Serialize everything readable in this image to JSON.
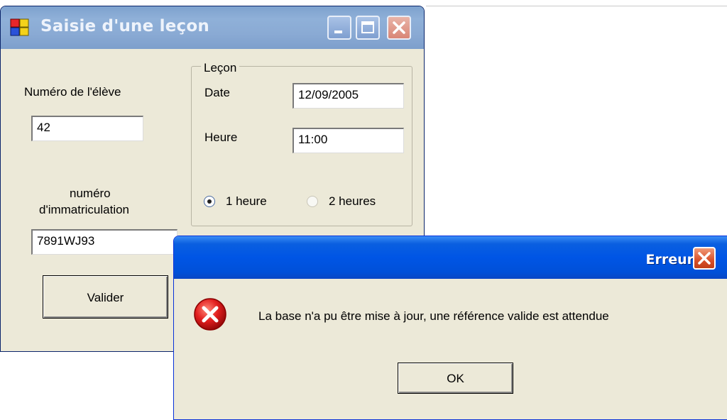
{
  "main_window": {
    "title": "Saisie d'une leçon",
    "student_label": "Numéro de l'élève",
    "student_value": "42",
    "plate_label_line1": "numéro",
    "plate_label_line2": "d'immatriculation",
    "plate_value": "7891WJ93",
    "validate_label": "Valider",
    "lesson_group": {
      "title": "Leçon",
      "date_label": "Date",
      "date_value": "12/09/2005",
      "hour_label": "Heure",
      "hour_value": "11:00",
      "option_1h": "1 heure",
      "option_2h": "2 heures",
      "selected_option": "1 heure"
    }
  },
  "error_dialog": {
    "title": "Erreur",
    "message": "La base n'a pu être mise à jour, une référence valide est attendue",
    "ok_label": "OK",
    "icon": "error-icon"
  },
  "colors": {
    "inactive_titlebar": "#8aaad4",
    "active_titlebar": "#0055e5",
    "dialog_face": "#ece9d8",
    "error_red": "#d81e1e"
  }
}
